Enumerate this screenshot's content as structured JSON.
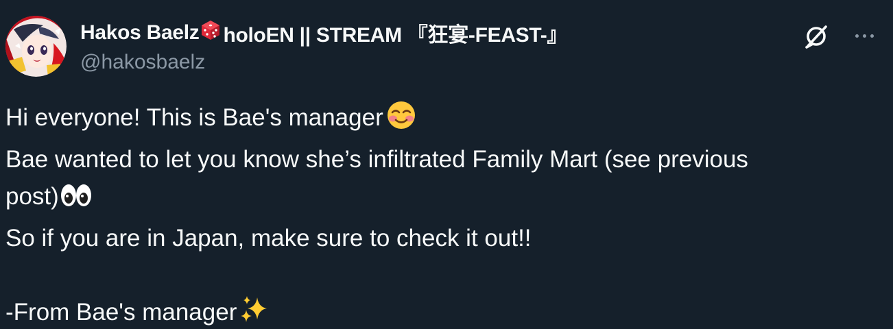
{
  "author": {
    "name_part1": "Hakos Baelz",
    "name_part2": "holoEN || STREAM 『狂宴-FEAST-』",
    "handle": "@hakosbaelz",
    "avatar_icon": "avatar-image",
    "name_emoji": "game-die-icon"
  },
  "header_icons": {
    "grok": "grok-icon",
    "more": "more-icon"
  },
  "tweet": {
    "line1": "Hi everyone! This is Bae's manager",
    "line2": "Bae wanted to let you know she’s infiltrated Family Mart (see previous",
    "line3": "post)",
    "line4": "So if you are in Japan, make sure to check it out!!",
    "line5": "",
    "line6": "-From Bae's manager"
  },
  "colors": {
    "background": "#15202b",
    "text_primary": "#f7f9f9",
    "text_secondary": "#8b98a5"
  }
}
